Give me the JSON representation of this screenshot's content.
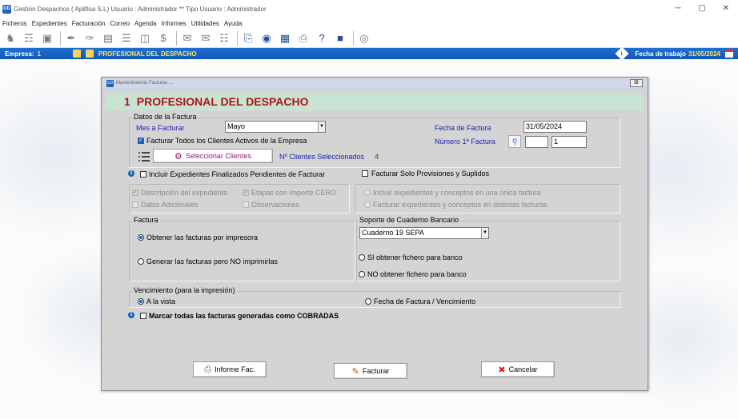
{
  "window": {
    "title": "Gestión Despachos  ( Aplifisa S.L)  Usuario : Administrador  **  Tipo Usuario : Administrador",
    "app_icon": "GD",
    "controls": [
      "─",
      "▢",
      "✕"
    ]
  },
  "menu": [
    "Ficheros",
    "Expedientes",
    "Facturación",
    "Correo",
    "Agenda",
    "Informes",
    "Utilidades",
    "Ayuda"
  ],
  "empresa_bar": {
    "label": "Empresa:",
    "number": "1",
    "name": "PROFESIONAL DEL DESPACHO",
    "fecha_label": "Fecha de trabajo",
    "fecha_value": "31/05/2024"
  },
  "dialog": {
    "title": "Mantenimiento Facturas ...",
    "close_label": "⊠",
    "icon": "GD",
    "header_number": "1",
    "header_name": "PROFESIONAL DEL DESPACHO",
    "datos": {
      "group_label": "Datos de la Factura",
      "mes_label": "Mes a Facturar",
      "mes_value": "Mayo",
      "fecha_label": "Fecha de Factura",
      "fecha_value": "31/05/2024",
      "todos_label": "Facturar Todos los Clientes Activos de la Empresa",
      "numero_label": "Número 1ª Factura",
      "numero_serie": "",
      "numero_value": "1",
      "seleccionar_label": "Seleccionar Clientes",
      "num_clientes_label": "Nº Clientes Seleccionados",
      "num_clientes_value": "4"
    },
    "incluir_finalizados_label": "Incluir Expedientes Finalizados Pendientes de Facturar",
    "solo_provisiones_label": "Facturar Solo Provisiones y Suplidos",
    "opciones_izq": {
      "descripcion": "Descripción del expediente",
      "etapas": "Etapas con importe CERO",
      "datos_adicionales": "Datos Adicionales",
      "observaciones": "Observaciones"
    },
    "opciones_der": {
      "unica": "Incluir expedientes y conceptos en una única factura",
      "distintas": "Facturar expedientes y conceptos en distintas facturas"
    },
    "factura": {
      "group_label": "Factura",
      "impresora": "Obtener las facturas por impresora",
      "no_imprimir": "Generar las facturas pero NO imprimirlas"
    },
    "soporte": {
      "group_label": "Soporte de Cuaderno Bancario",
      "cuaderno_value": "Cuaderno 19 SEPA",
      "si_fichero": "SI obtener fichero para banco",
      "no_fichero": "NO obtener fichero para banco"
    },
    "vencimiento": {
      "group_label": "Vencimiento (para la impresión)",
      "vista": "A la vista",
      "fecha_venc": "Fecha de Factura / Vencimiento"
    },
    "cobradas_label": "Marcar todas las facturas generadas como COBRADAS",
    "buttons": {
      "informe": "Informe Fac.",
      "facturar": "Facturar",
      "cancelar": "Cancelar"
    }
  }
}
